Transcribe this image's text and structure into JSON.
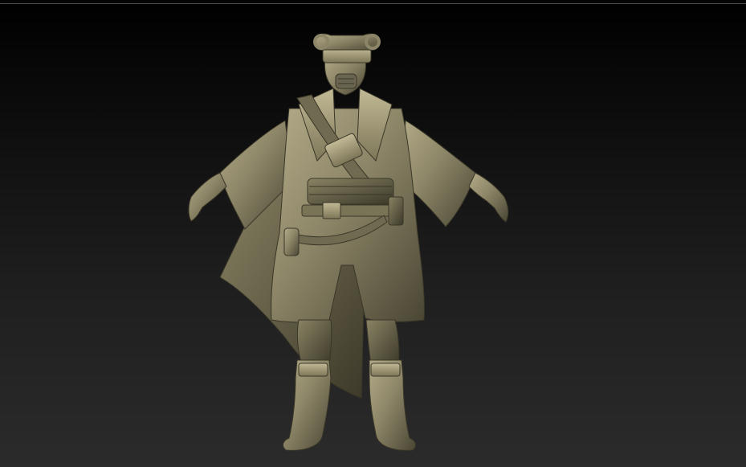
{
  "viewport": {
    "background_top": "#000000",
    "background_bottom": "#2b2b2b",
    "frame_line_color": "#4a4a4a"
  },
  "model": {
    "material_color": "#8c8567",
    "material_highlight": "#b3ab88",
    "material_shadow": "#4a4634"
  }
}
